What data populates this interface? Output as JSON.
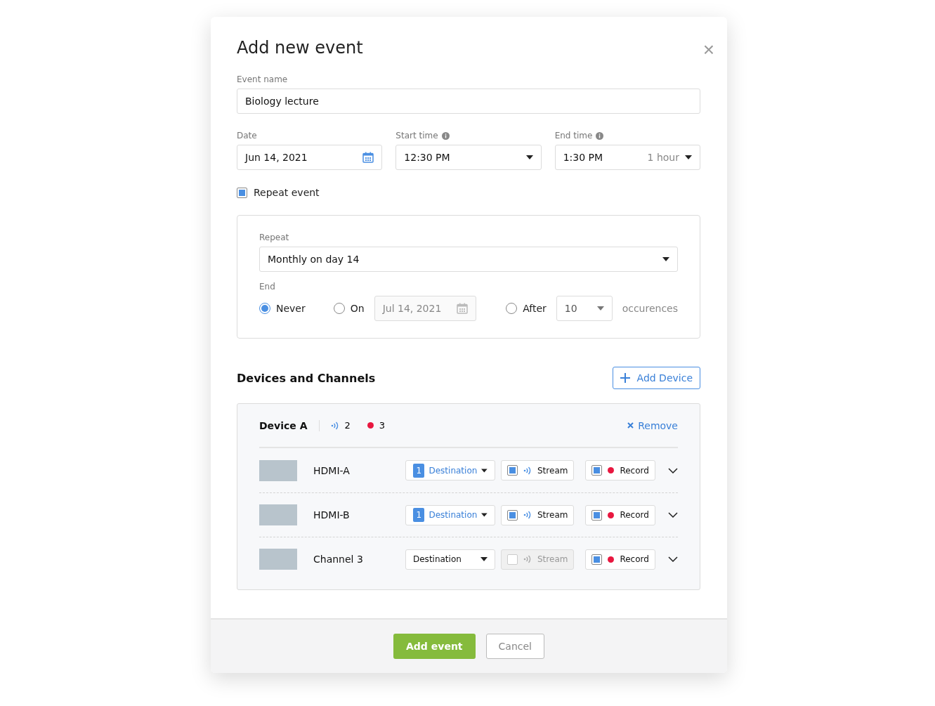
{
  "dialog": {
    "title": "Add new event",
    "close": "×"
  },
  "event_name": {
    "label": "Event name",
    "value": "Biology lecture"
  },
  "date": {
    "label": "Date",
    "value": "Jun 14, 2021"
  },
  "start_time": {
    "label": "Start time",
    "value": "12:30 PM"
  },
  "end_time": {
    "label": "End time",
    "value": "1:30 PM",
    "duration": "1 hour"
  },
  "repeat_event": {
    "label": "Repeat event",
    "checked": true
  },
  "repeat": {
    "label": "Repeat",
    "value": "Monthly on day 14",
    "end_label": "End",
    "end_options": [
      {
        "kind": "plain",
        "label": "Never",
        "selected": true
      },
      {
        "kind": "date",
        "label": "On",
        "selected": false,
        "value": "Jul 14, 2021"
      },
      {
        "kind": "count",
        "label": "After",
        "selected": false,
        "value": "10",
        "suffix": "occurences"
      }
    ]
  },
  "devices_section": {
    "title": "Devices and Channels",
    "add_button": "Add Device"
  },
  "device": {
    "name": "Device A",
    "stream_count": "2",
    "record_count": "3",
    "remove": "Remove",
    "channels": [
      {
        "name": "HDMI-A",
        "destination": "Destination",
        "badge": "1",
        "stream": {
          "label": "Stream",
          "checked": true,
          "disabled": false
        },
        "record": {
          "label": "Record",
          "checked": true
        }
      },
      {
        "name": "HDMI-B",
        "destination": "Destination",
        "badge": "1",
        "stream": {
          "label": "Stream",
          "checked": true,
          "disabled": false
        },
        "record": {
          "label": "Record",
          "checked": true
        }
      },
      {
        "name": "Channel 3",
        "destination": "Destination",
        "stream": {
          "label": "Stream",
          "checked": false,
          "disabled": true
        },
        "record": {
          "label": "Record",
          "checked": true
        }
      }
    ]
  },
  "footer": {
    "primary": "Add event",
    "secondary": "Cancel"
  }
}
